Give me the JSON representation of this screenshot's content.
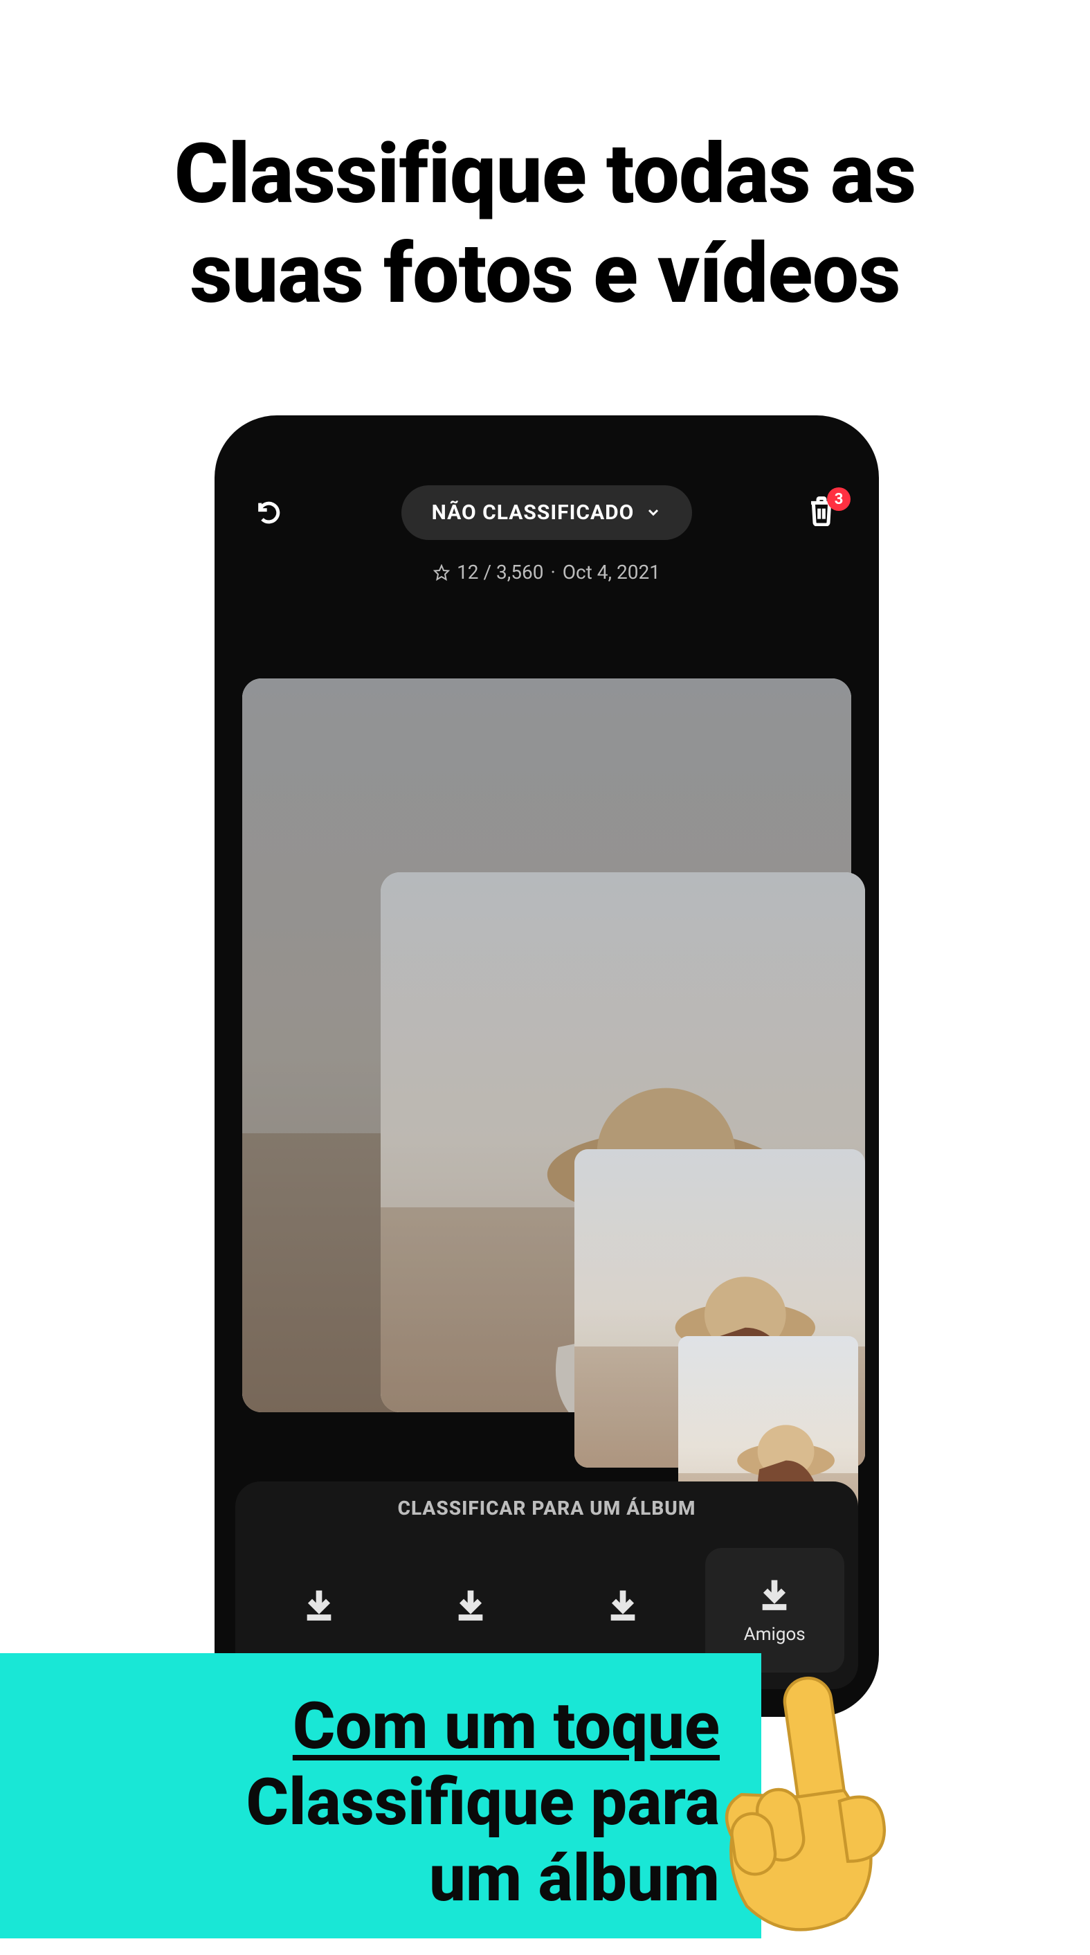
{
  "headline": {
    "line1": "Classifique todas as",
    "line2": "suas fotos e vídeos"
  },
  "topbar": {
    "filter_label": "NÃO CLASSIFICADO",
    "trash_badge": "3"
  },
  "meta": {
    "counter": "12 / 3,560",
    "separator": "·",
    "date": "Oct 4, 2021"
  },
  "panel": {
    "title": "CLASSIFICAR PARA UM ÁLBUM"
  },
  "albums": [
    {
      "label": ""
    },
    {
      "label": ""
    },
    {
      "label": ""
    },
    {
      "label": "Amigos"
    }
  ],
  "caption": {
    "line1": "Com um toque",
    "line2": "Classifique para",
    "line3": "um álbum"
  }
}
